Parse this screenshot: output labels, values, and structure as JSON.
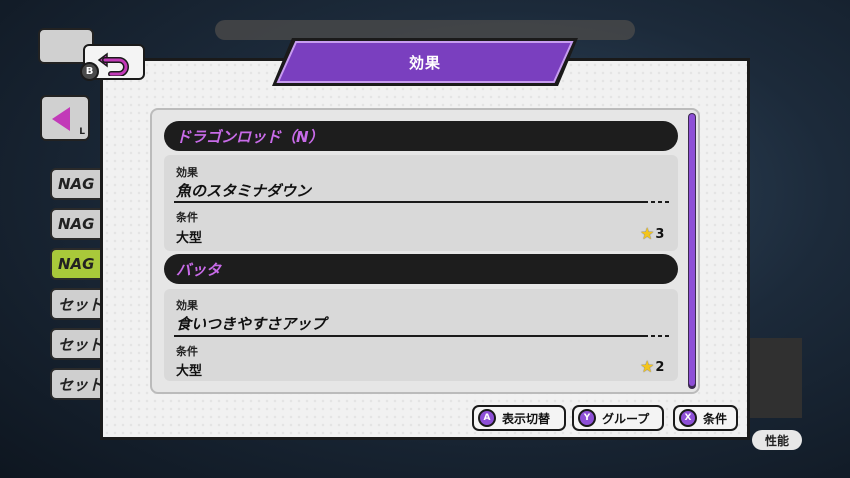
{
  "modal": {
    "title": "効果",
    "back_button_key": "B",
    "entries": [
      {
        "name": "ドラゴンロッド（N）",
        "effect_label": "効果",
        "effect": "魚のスタミナダウン",
        "condition_label": "条件",
        "condition": "大型",
        "stars": "3"
      },
      {
        "name": "バッタ",
        "effect_label": "効果",
        "effect": "食いつきやすさアップ",
        "condition_label": "条件",
        "condition": "大型",
        "stars": "2"
      }
    ],
    "footer": [
      {
        "key": "A",
        "label": "表示切替"
      },
      {
        "key": "Y",
        "label": "グループ"
      },
      {
        "key": "X",
        "label": "条件"
      }
    ]
  },
  "background": {
    "list_items": [
      "NAG",
      "NAG",
      "NAG",
      "セット",
      "セット",
      "セット"
    ],
    "l_key": "L",
    "b_key": "B",
    "perf_label": "性能"
  },
  "colors": {
    "accent": "#8d4fd6",
    "header_text": "#c86be8",
    "selected_bg": "#a9c93a"
  }
}
